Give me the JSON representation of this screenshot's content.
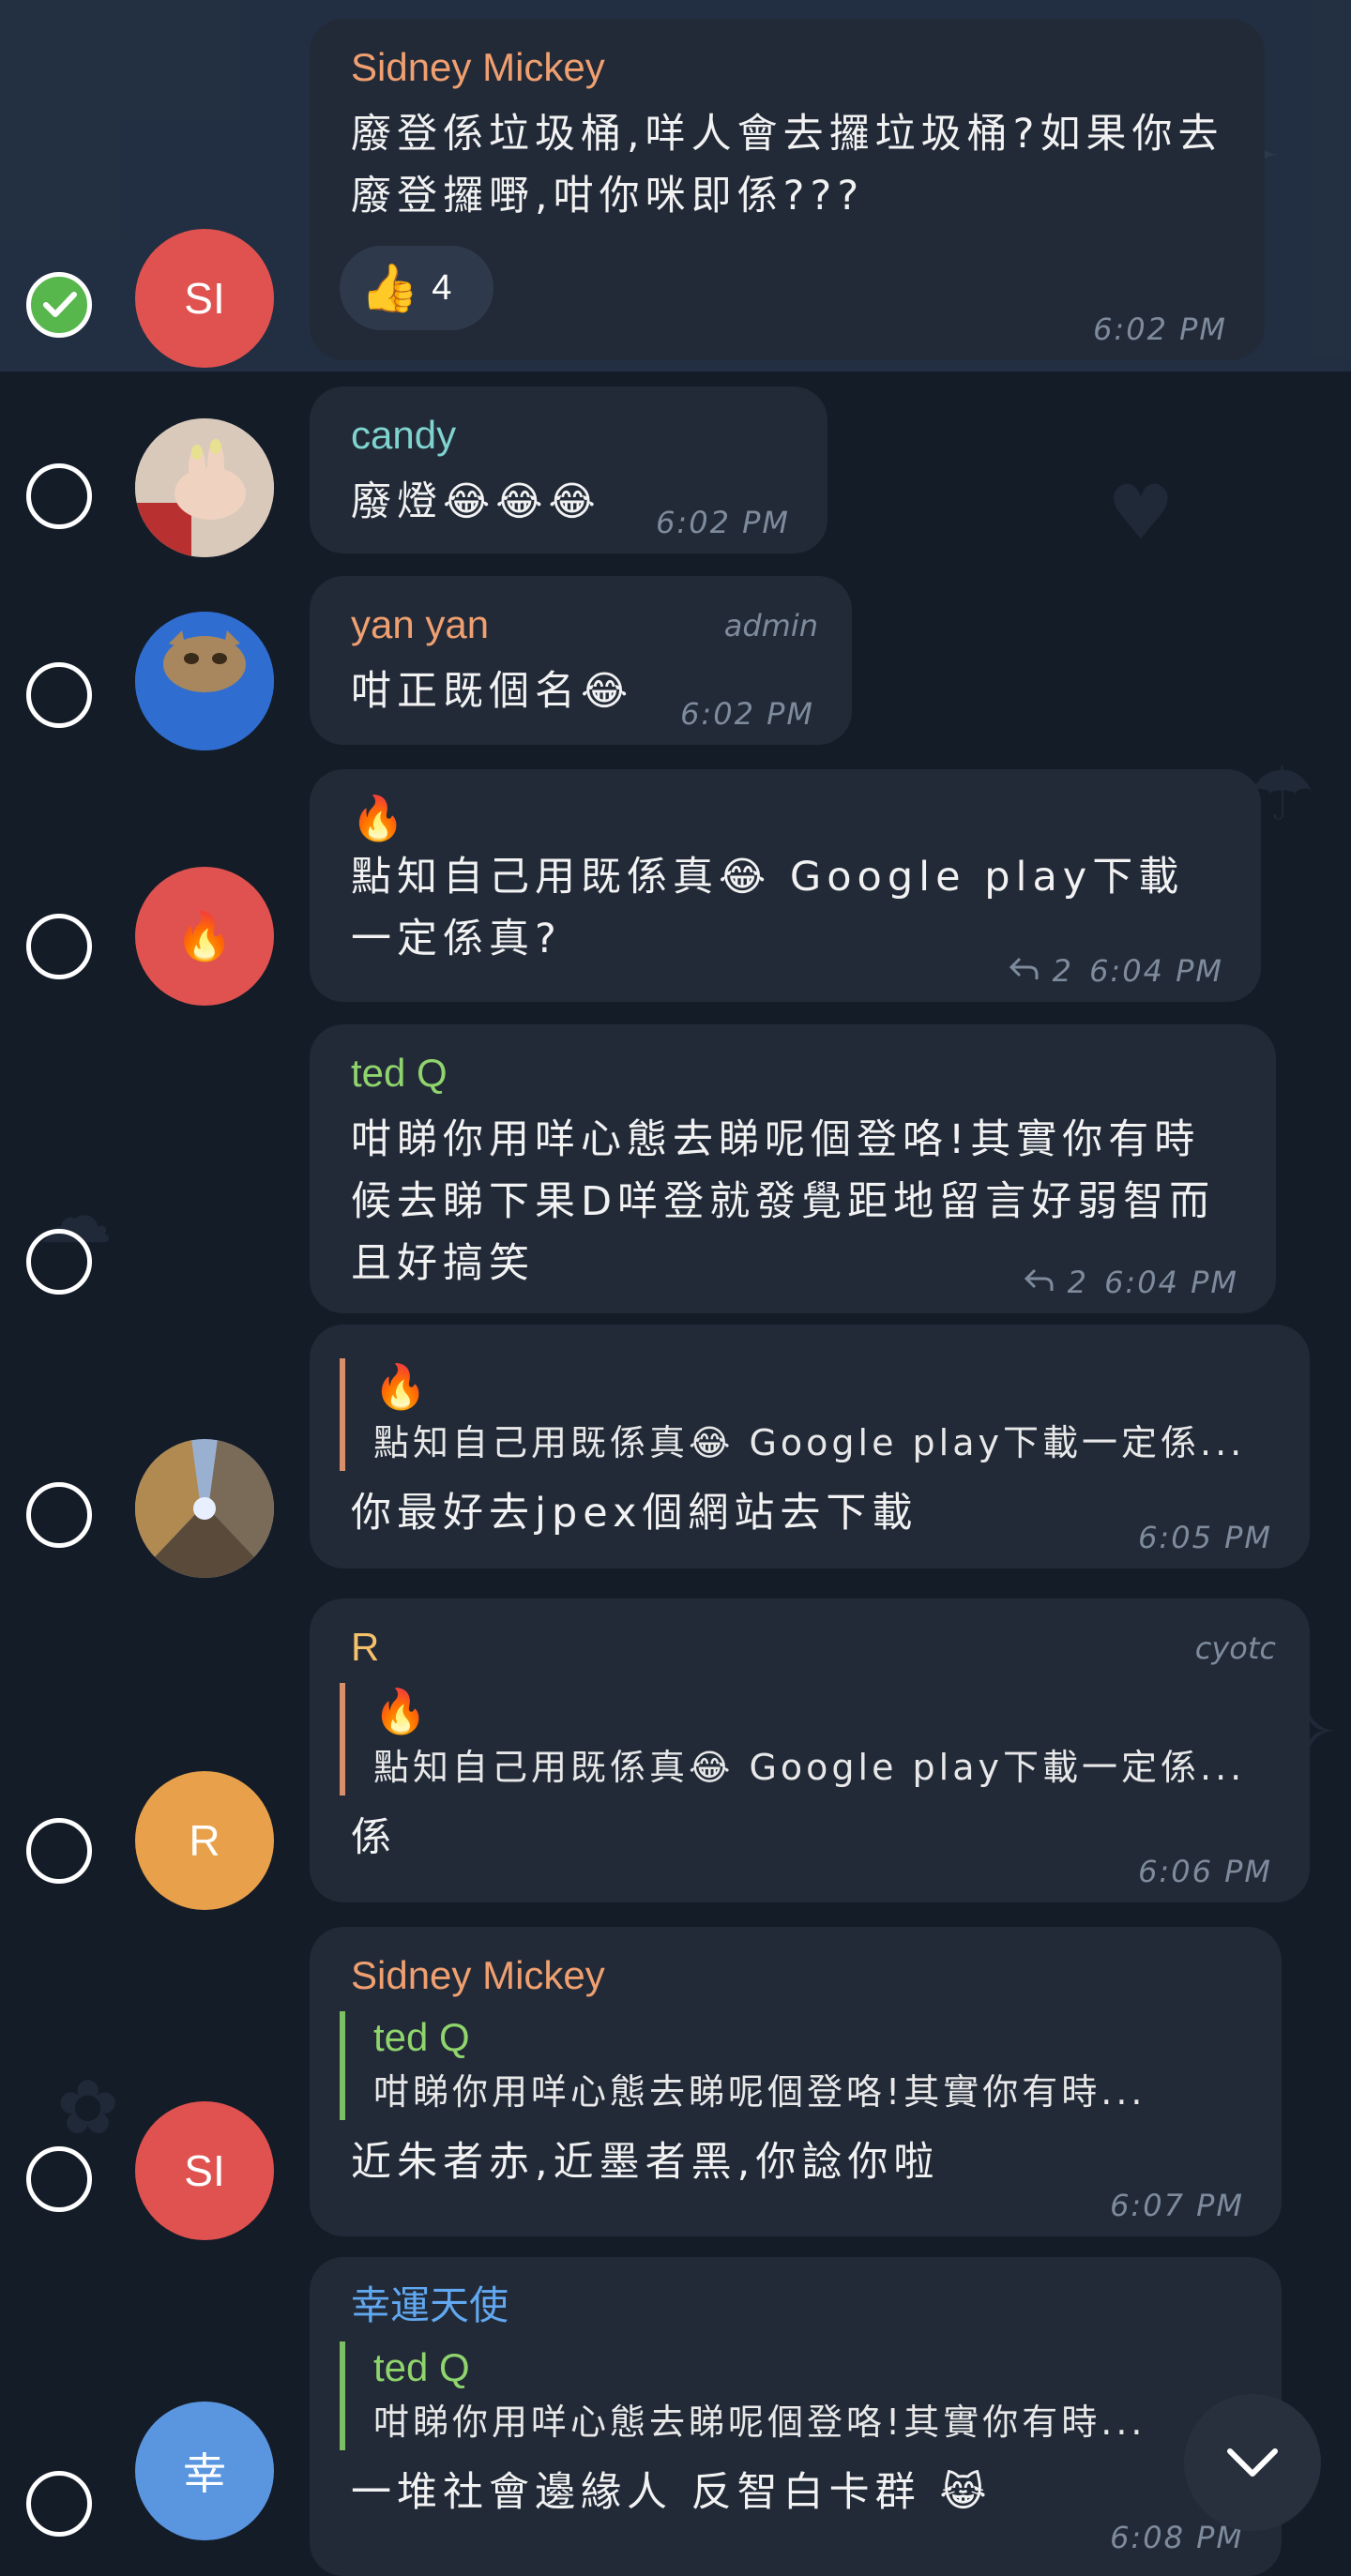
{
  "messages": [
    {
      "sender": "Sidney Mickey",
      "text": "廢登係垃圾桶,咩人會去攞垃圾桶?如果你去廢登攞嘢,咁你咪即係???",
      "time": "6:02 PM",
      "reaction": {
        "emoji": "👍",
        "count": "4"
      },
      "avatar_initials": "SI",
      "selected": true
    },
    {
      "sender": "candy",
      "text": "廢燈😂😂😂",
      "time": "6:02 PM"
    },
    {
      "sender": "yan yan",
      "badge": "admin",
      "text": "咁正既個名😂",
      "time": "6:02 PM"
    },
    {
      "fire": "🔥",
      "text": "點知自己用既係真😂 Google play下載一定係真?",
      "replies": "2",
      "time": "6:04 PM",
      "avatar_initials": "🔥"
    },
    {
      "sender": "ted Q",
      "text": "咁睇你用咩心態去睇呢個登咯!其實你有時候去睇下果D咩登就發覺距地留言好弱智而且好搞笑",
      "replies": "2",
      "time": "6:04 PM"
    },
    {
      "quote": {
        "fire": "🔥",
        "text": "點知自己用既係真😂 Google play下載一定係..."
      },
      "text": "你最好去jpex個網站去下載",
      "time": "6:05 PM"
    },
    {
      "sender": "R",
      "badge": "cyotc",
      "quote": {
        "fire": "🔥",
        "text": "點知自己用既係真😂 Google play下載一定係..."
      },
      "text": "係",
      "time": "6:06 PM",
      "avatar_initials": "R"
    },
    {
      "sender": "Sidney Mickey",
      "quote": {
        "name": "ted Q",
        "text": "咁睇你用咩心態去睇呢個登咯!其實你有時..."
      },
      "text": "近朱者赤,近墨者黑,你諗你啦",
      "time": "6:07 PM",
      "avatar_initials": "SI"
    },
    {
      "sender": "幸運天使",
      "quote": {
        "name": "ted Q",
        "text": "咁睇你用咩心態去睇呢個登咯!其實你有時..."
      },
      "text": "一堆社會邊緣人 反智白卡群 😹",
      "time": "6:08 PM",
      "avatar_initials": "幸"
    }
  ],
  "colors": {
    "background": "#141c28",
    "bubble": "#222a38",
    "sidney": "#f0a070",
    "candy": "#7fd4cf",
    "yanyan": "#f0a070",
    "tedq": "#8fd46c",
    "r": "#f5c16a",
    "lucky": "#62a8f0",
    "time": "#7e8b9c",
    "avatar_red": "#e0524f",
    "avatar_orange": "#e8a04a",
    "avatar_blue": "#5a96e0",
    "check_green": "#57b74c"
  },
  "icons": {
    "checkbox_checked": "check-icon",
    "reply_indicator": "reply-arrow-icon",
    "scroll_down": "chevron-down-icon"
  }
}
